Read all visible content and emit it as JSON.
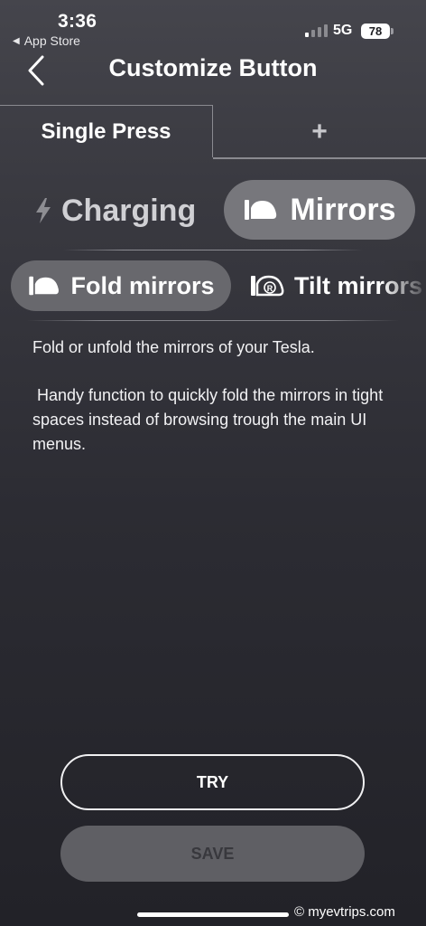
{
  "status_bar": {
    "time": "3:36",
    "back_app": "App Store",
    "network": "5G",
    "battery": "78"
  },
  "header": {
    "title": "Customize Button",
    "back_icon": "chevron-left-icon"
  },
  "tabs": {
    "single_press": "Single Press",
    "add": "+"
  },
  "categories": {
    "charging": "Charging",
    "mirrors": "Mirrors",
    "selected": "Mirrors"
  },
  "actions": {
    "fold": "Fold mirrors",
    "tilt": "Tilt mirrors",
    "selected": "Fold mirrors"
  },
  "description": {
    "line1": "Fold or unfold the mirrors of your Tesla.",
    "line2": " Handy function to quickly fold the mirrors in tight spaces instead of browsing trough the main UI menus."
  },
  "buttons": {
    "try": "TRY",
    "save": "SAVE"
  },
  "watermark": "© myevtrips.com",
  "colors": {
    "selected_pill": "#77777c",
    "action_pill": "#68686d",
    "save_disabled": "#5f5f64"
  }
}
